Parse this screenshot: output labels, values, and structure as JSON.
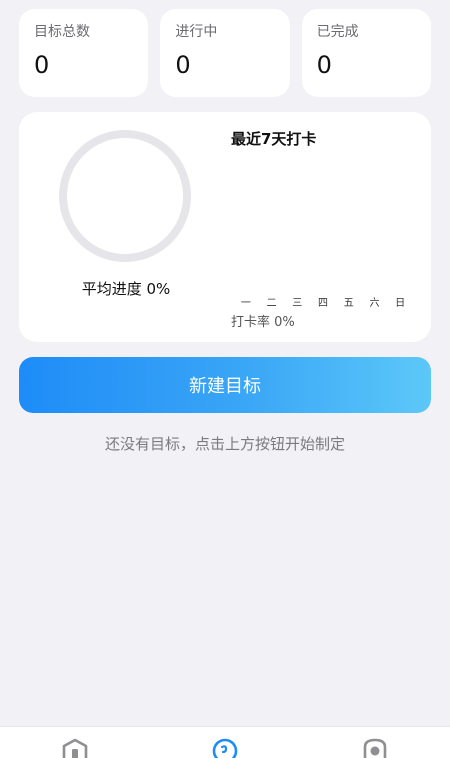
{
  "stats": [
    {
      "label": "目标总数",
      "value": "0"
    },
    {
      "label": "进行中",
      "value": "0"
    },
    {
      "label": "已完成",
      "value": "0"
    }
  ],
  "progress": {
    "average_label": "平均进度 0%",
    "average_percent": 0
  },
  "week": {
    "title": "最近7天打卡",
    "days": [
      "一",
      "二",
      "三",
      "四",
      "五",
      "六",
      "日"
    ],
    "rate_label": "打卡率 0%"
  },
  "actions": {
    "new_goal_label": "新建目标"
  },
  "empty_hint": "还没有目标，点击上方按钮开始制定",
  "tabbar": {
    "items": [
      {
        "icon": "home-icon",
        "active": false
      },
      {
        "icon": "target-icon",
        "active": true
      },
      {
        "icon": "profile-icon",
        "active": false
      }
    ]
  },
  "colors": {
    "accent": "#1e8cf7",
    "accent_light": "#5cc8f8",
    "background": "#f1f1f6",
    "ring_track": "#e6e6ea"
  }
}
